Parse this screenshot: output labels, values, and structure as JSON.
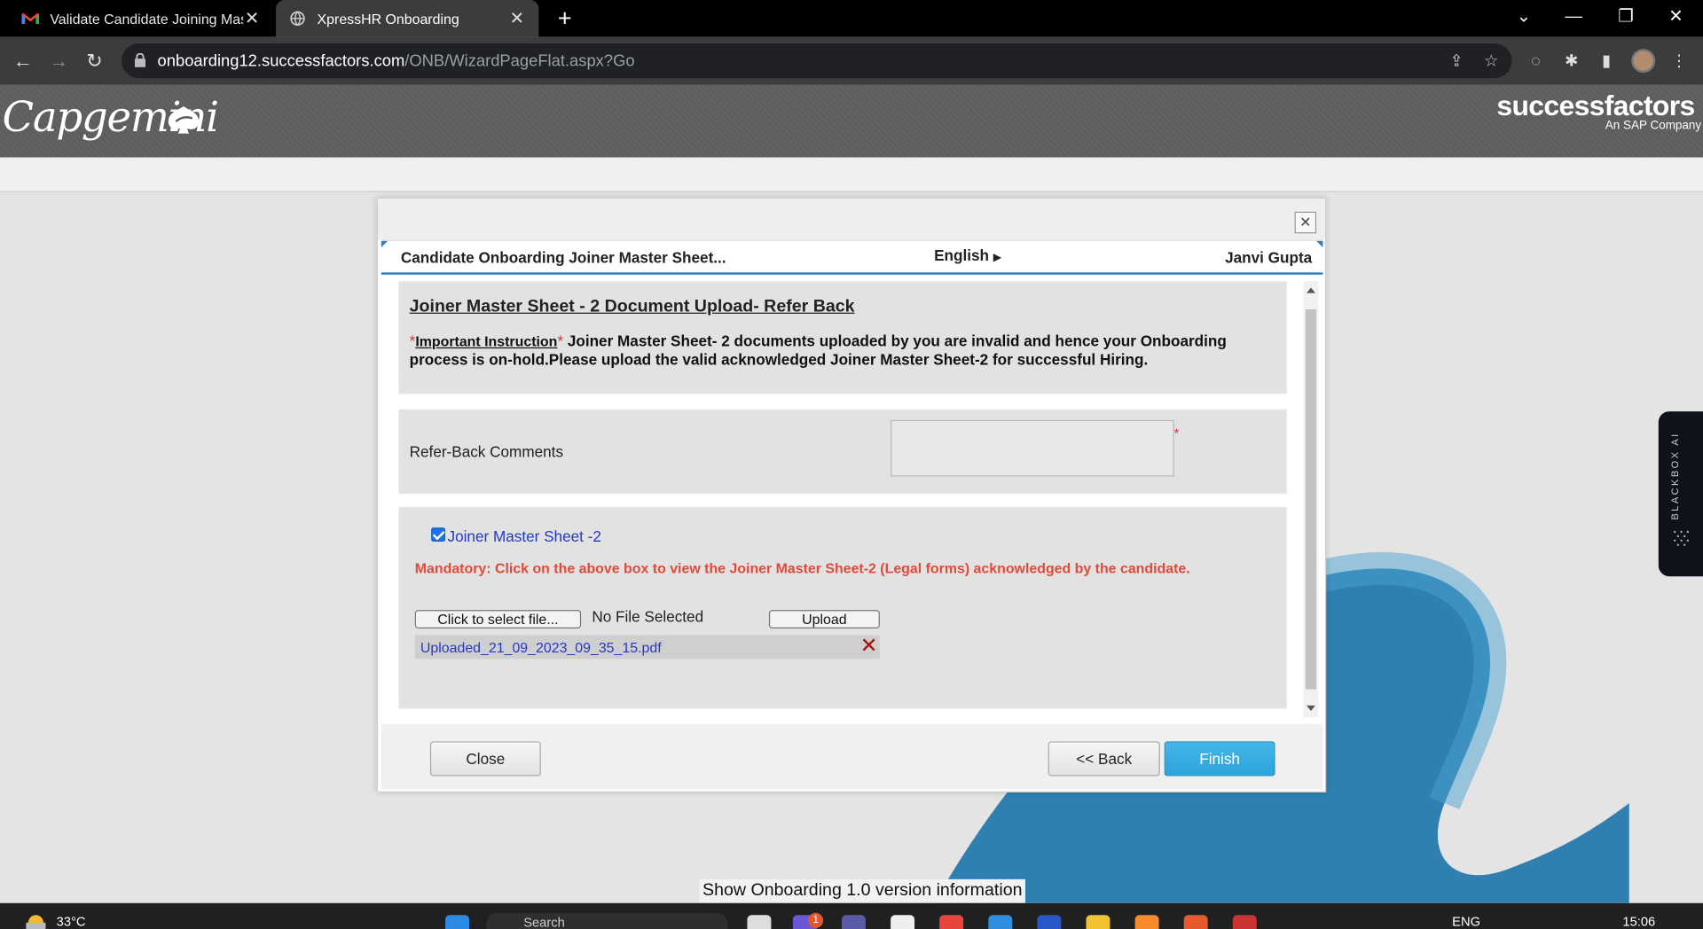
{
  "browser": {
    "tabs": [
      {
        "title": "Validate Candidate Joining Maste",
        "icon": "gmail-icon"
      },
      {
        "title": "XpressHR Onboarding",
        "icon": "globe-icon"
      }
    ],
    "url_host": "onboarding12.successfactors.com",
    "url_path": "/ONB/WizardPageFlat.aspx?Go"
  },
  "header": {
    "left_logo": "Capgemini",
    "right_logo": "successfactors",
    "right_logo_sub": "An SAP Company"
  },
  "wizard": {
    "title": "Candidate Onboarding Joiner Master Sheet...",
    "language": "English",
    "user": "Janvi Gupta"
  },
  "section": {
    "title": "Joiner Master Sheet - 2 Document Upload- Refer Back",
    "required_mark": "*",
    "instruction_label": "Important Instruction",
    "instruction_text": " Joiner Master Sheet- 2 documents uploaded by you are invalid and hence your Onboarding process is on-hold.Please upload the valid acknowledged Joiner Master Sheet-2 for successful Hiring."
  },
  "refer_back": {
    "label": "Refer-Back Comments",
    "value": "",
    "required_mark": "*"
  },
  "document": {
    "checkbox_label": "Joiner Master Sheet -2",
    "checked": true,
    "mandatory_text": "Mandatory: Click on the above box to view the Joiner Master Sheet-2 (Legal forms) acknowledged by the candidate.",
    "select_button": "Click to select file...",
    "no_file_text": "No File Selected",
    "upload_button": "Upload",
    "uploaded_file": "Uploaded_21_09_2023_09_35_15.pdf"
  },
  "footer": {
    "close": "Close",
    "back": "<< Back",
    "finish": "Finish"
  },
  "side_widget": {
    "label": "BLACKBOX AI"
  },
  "version_link": "Show Onboarding 1.0 version information",
  "taskbar": {
    "temperature": "33°C",
    "search_placeholder": "Search",
    "language": "ENG",
    "time": "15:06",
    "badge_count": "1"
  },
  "colors": {
    "finish_button": "#2ba3da",
    "mandatory_text": "#e04a3b",
    "link": "#2438c8",
    "wizard_accent": "#2f7fc7"
  }
}
